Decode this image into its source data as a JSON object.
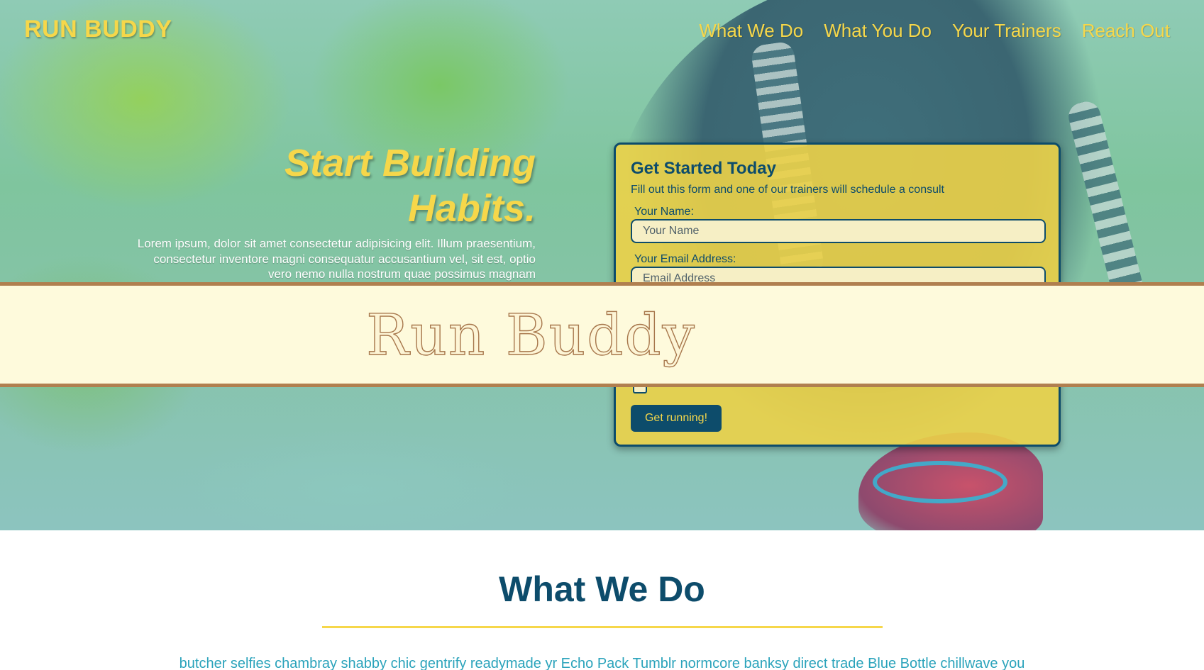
{
  "header": {
    "logo": "RUN BUDDY",
    "nav": [
      "What We Do",
      "What You Do",
      "Your Trainers",
      "Reach Out"
    ]
  },
  "hero": {
    "headline": "Start Building Habits.",
    "body": "Lorem ipsum, dolor sit amet consectetur adipisicing elit. Illum praesentium, consectetur inventore magni consequatur accusantium vel, sit est, optio vero nemo nulla nostrum quae possimus magnam"
  },
  "form": {
    "title": "Get Started Today",
    "subtitle": "Fill out this form and one of our trainers will schedule a consult",
    "name_label": "Your Name:",
    "name_placeholder": "Your Name",
    "email_label": "Your Email Address:",
    "email_placeholder": "Email Address",
    "submit_label": "Get running!"
  },
  "banner": {
    "text": "Run Buddy"
  },
  "section": {
    "title": "What We Do",
    "text": "butcher selfies chambray shabby chic gentrify readymade yr Echo Pack Tumblr normcore banksy direct trade Blue Bottle chillwave you"
  },
  "colors": {
    "accent": "#f6d74a",
    "primary": "#0d4c6b",
    "link": "#2aa3bb",
    "banner_bg": "#fefadc",
    "banner_border": "#b07f4f"
  }
}
